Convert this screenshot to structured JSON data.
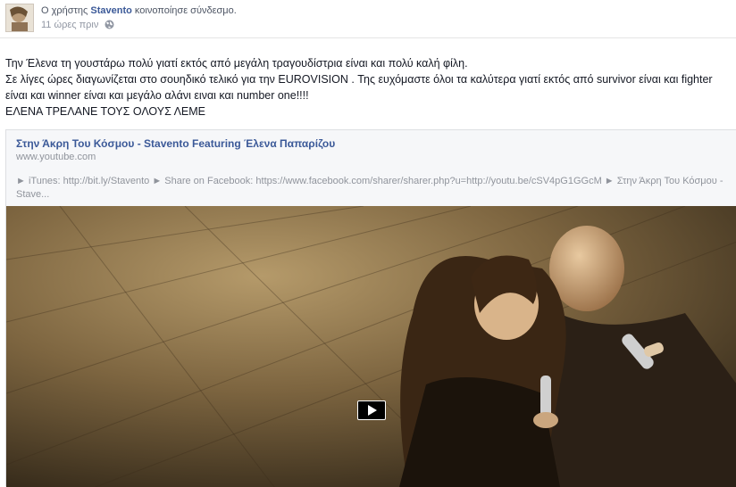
{
  "post": {
    "headline_prefix": "Ο χρήστης",
    "author": "Stavento",
    "headline_suffix": "κοινοποίησε σύνδεσμο.",
    "time": "11 ώρες πριν",
    "privacy_icon": "globe-icon",
    "message": [
      "Την Έλενα τη γουστάρω πολύ γιατί εκτός από μεγάλη τραγουδίστρια είναι και πολύ καλή φίλη.",
      "Σε λίγες ώρες διαγωνίζεται στο σουηδικό τελικό για την EUROVISION . Της ευχόμαστε όλοι τα καλύτερα γιατί εκτός από survivor είναι και fighter είναι και winner είναι και μεγάλο αλάνι ειναι και number one!!!!",
      "ΕΛΕΝΑ ΤΡΕΛΑΝΕ ΤΟΥΣ ΟΛΟΥΣ ΛΕΜΕ"
    ]
  },
  "share": {
    "title": "Στην Άκρη Του Κόσμου - Stavento Featuring Έλενα Παπαρίζου",
    "domain": "www.youtube.com",
    "description": "► iTunes: http://bit.ly/Stavento ► Share on Facebook: https://www.facebook.com/sharer/sharer.php?u=http://youtu.be/cSV4pG1GGcM ► Στην Άκρη Του Κόσμου - Stave...",
    "play_icon": "play-icon"
  },
  "colors": {
    "link": "#3b5998",
    "muted": "#90949c",
    "video_sepia": "#2a2114"
  }
}
